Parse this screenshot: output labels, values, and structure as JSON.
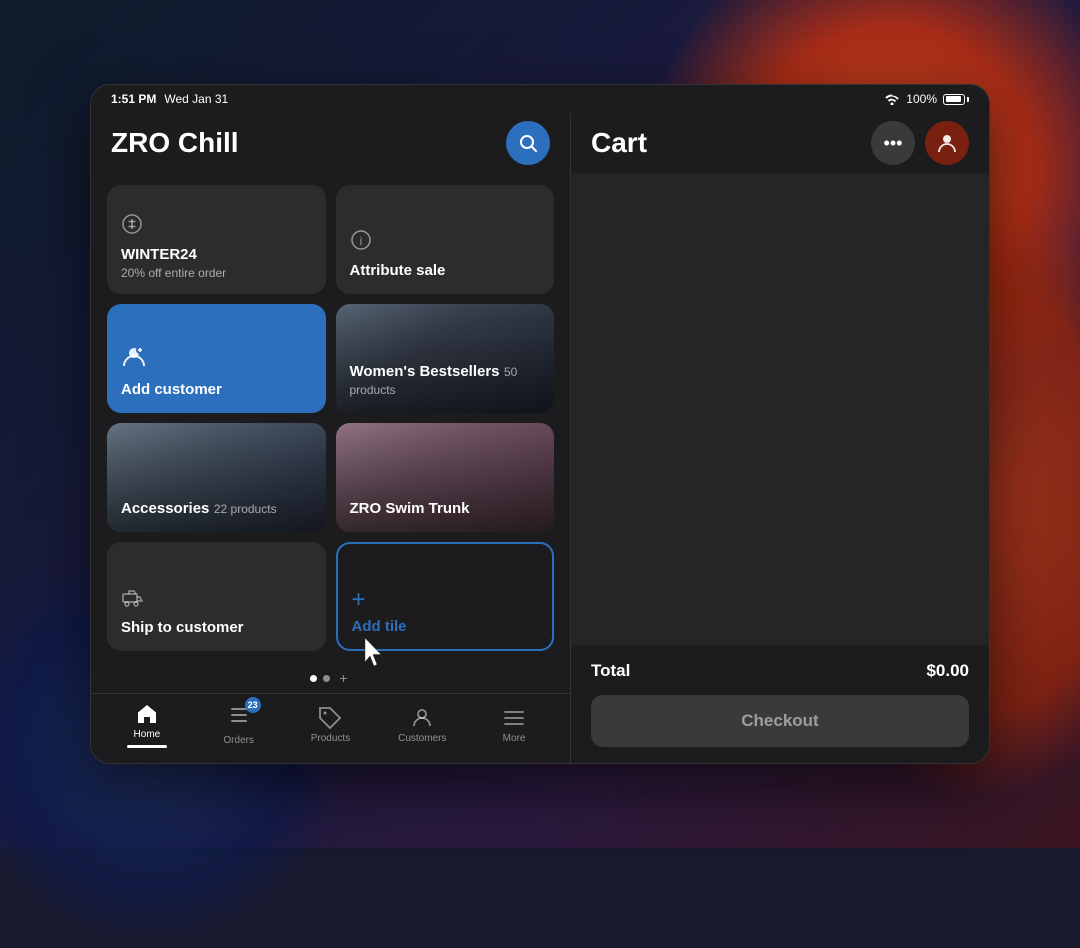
{
  "status_bar": {
    "time": "1:51 PM",
    "date": "Wed Jan 31",
    "battery": "100%"
  },
  "left_panel": {
    "title": "ZRO Chill",
    "tiles": [
      {
        "id": "tile-promo",
        "type": "dark",
        "icon": "promo",
        "title": "WINTER24",
        "subtitle": "20% off entire order"
      },
      {
        "id": "tile-attribute",
        "type": "dark",
        "icon": "attribute",
        "title": "Attribute sale",
        "subtitle": ""
      },
      {
        "id": "tile-add-customer",
        "type": "blue",
        "icon": "person",
        "title": "Add customer",
        "subtitle": ""
      },
      {
        "id": "tile-womens",
        "type": "image-womens",
        "icon": "",
        "title": "Women's Bestsellers",
        "subtitle": "50 products"
      },
      {
        "id": "tile-accessories",
        "type": "image-accessories",
        "icon": "",
        "title": "Accessories",
        "subtitle": "22 products"
      },
      {
        "id": "tile-swim",
        "type": "image-swim",
        "icon": "",
        "title": "ZRO Swim Trunk",
        "subtitle": ""
      },
      {
        "id": "tile-ship",
        "type": "dark",
        "icon": "ship",
        "title": "Ship to customer",
        "subtitle": ""
      },
      {
        "id": "tile-add",
        "type": "outline",
        "icon": "plus",
        "title": "Add tile",
        "subtitle": ""
      }
    ],
    "pagination": {
      "dots": 2,
      "active_dot": 0
    }
  },
  "bottom_nav": {
    "items": [
      {
        "id": "home",
        "label": "Home",
        "icon": "house",
        "active": true,
        "badge": ""
      },
      {
        "id": "orders",
        "label": "Orders",
        "icon": "list",
        "active": false,
        "badge": "23"
      },
      {
        "id": "products",
        "label": "Products",
        "icon": "tag",
        "active": false,
        "badge": ""
      },
      {
        "id": "customers",
        "label": "Customers",
        "icon": "person",
        "active": false,
        "badge": ""
      },
      {
        "id": "more",
        "label": "More",
        "icon": "menu",
        "active": false,
        "badge": ""
      }
    ]
  },
  "right_panel": {
    "title": "Cart",
    "buttons": {
      "more": "•••",
      "user": "👤"
    },
    "total_label": "Total",
    "total_value": "$0.00",
    "checkout_label": "Checkout"
  }
}
